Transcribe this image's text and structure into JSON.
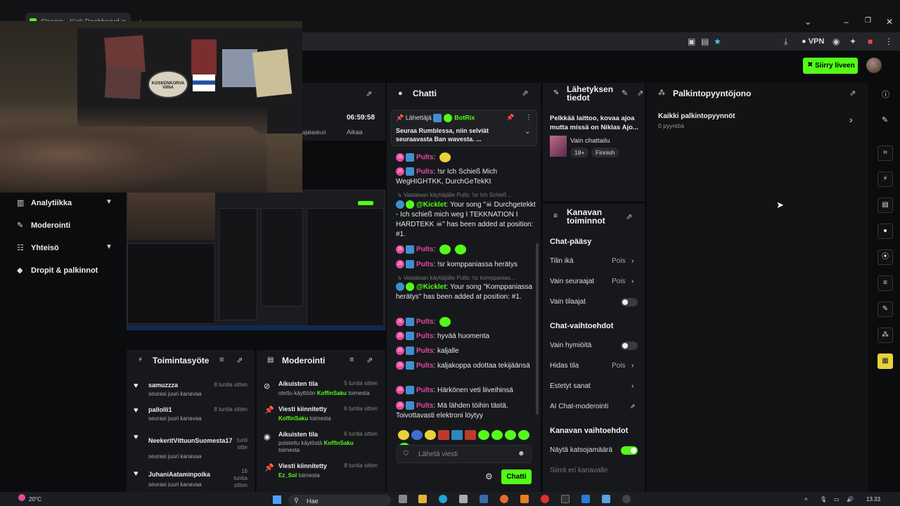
{
  "browser": {
    "tab_title": "Stream - Kick Dashboard",
    "vpn_label": "VPN",
    "win_min": "–",
    "win_max": "❐",
    "win_close": "✕",
    "new_tab": "+"
  },
  "header": {
    "go_live_label": "Siirry liveen"
  },
  "sidebar": {
    "items": [
      {
        "label": "Analytiikka"
      },
      {
        "label": "Moderointi"
      },
      {
        "label": "Yhteisö"
      },
      {
        "label": "Dropit & palkinnot"
      }
    ]
  },
  "webcam": {
    "badge_text": "KOSKENKORVA VIINA"
  },
  "stats": {
    "time_value": "06:59:58",
    "time_label": "Aikaa",
    "counter_label": "ajalaskuri"
  },
  "chat": {
    "title": "Chatti",
    "pinned": {
      "pinned_by_prefix": "Lähettäjä",
      "pinned_by_user": "BotRix",
      "text": "Seuraa Rumblessa, niin selviät seuraavasta Ban wavesta.",
      "ellipsis": "..."
    },
    "messages": [
      {
        "user": "Pults",
        "text": ""
      },
      {
        "user": "Pults",
        "text": "!sr Ich Schieß Mich WegHIGHTKK, DurchGeTekKt"
      },
      {
        "reply": "Vastataan käyttäjälle Pults: !sr Ich Schieß ..."
      },
      {
        "user": "@Kicklet",
        "text": "Your song \"☠ Durchgetekkt - Ich schieß mich weg I TEKKNATION I HARDTEKK ☠\" has been added at position: #1."
      },
      {
        "user": "Pults",
        "text": ""
      },
      {
        "user": "Pults",
        "text": "!sr komppaniassa herätys"
      },
      {
        "reply": "Vastataan käyttäjälle Pults: !sr komppanias..."
      },
      {
        "user": "@Kicklet",
        "text": "Your song \"Komppaniassa herätys\" has been added at position: #1."
      },
      {
        "user": "Pults",
        "text": ""
      },
      {
        "user": "Pults",
        "text": "hyvää huomenta"
      },
      {
        "user": "Pults",
        "text": "kaljalle"
      },
      {
        "user": "Pults",
        "text": "kaljakoppa odottaa tekijäänsä"
      },
      {
        "user": "Pults",
        "text": "Härkönen veti liiveihinsä"
      },
      {
        "user": "Pults",
        "text": "Mä lähden töihin tästä. Toivottavasti elektroni löytyy"
      }
    ],
    "input_placeholder": "Lähetä viesti",
    "send_label": "Chatti"
  },
  "stream_info": {
    "title": "Lähetyksen tiedot",
    "stream_title": "Pelkkää laittoo, kovaa ajoa mutta missä on Niklas Ajo...",
    "category": "Vain chattailu",
    "tags": [
      "18+",
      "Finnish"
    ]
  },
  "channel_actions": {
    "title": "Kanavan toiminnot",
    "sections": [
      {
        "title": "Chat-pääsy"
      },
      {
        "title": "Chat-vaihtoehdot"
      },
      {
        "title": "Kanavan vaihtoehdot"
      }
    ],
    "rows": {
      "account_age": {
        "label": "Tilin ikä",
        "value": "Pois"
      },
      "followers_only": {
        "label": "Vain seuraajat",
        "value": "Pois"
      },
      "subs_only": {
        "label": "Vain tilaajat",
        "on": false
      },
      "emotes_only": {
        "label": "Vain hymiöitä",
        "on": false
      },
      "slow_mode": {
        "label": "Hidas tila",
        "value": "Pois"
      },
      "banned_words": {
        "label": "Estetyt sanat"
      },
      "ai_mod": {
        "label": "AI Chat-moderointi"
      },
      "show_viewers": {
        "label": "Näytä katsojamäärä",
        "on": true
      },
      "host": {
        "label": "Siirrä eri kanavalle"
      }
    }
  },
  "rewards": {
    "title": "Palkintopyyntöjono",
    "all_label": "Kaikki palkintopyynnöt",
    "count_label": "0 pyyntöä"
  },
  "activity": {
    "title": "Toimintasyöte",
    "items": [
      {
        "name": "samuzzza",
        "sub": "seurasi juuri kanavaa",
        "time": "8 tuntia sitten"
      },
      {
        "name": "pallolli1",
        "sub": "seurasi juuri kanavaa",
        "time": "8 tuntia sitten"
      },
      {
        "name": "NeekeritVittuunSuomesta17",
        "sub": "seurasi juuri kanavaa",
        "time": "tunti sitte"
      },
      {
        "name": "JuhaniAataminpoika",
        "sub": "seurasi juuri kanavaa",
        "time": "16 tuntia sitten"
      }
    ]
  },
  "moderation": {
    "title": "Moderointi",
    "items": [
      {
        "name": "Aikuisten tila",
        "pre": "otettu käyttöön",
        "user": "KoffinSaku",
        "post": "toimesta",
        "time": "5 tuntia sitten"
      },
      {
        "name": "Viesti kiinnitetty",
        "pre": "",
        "user": "KoffinSaku",
        "post": "toimesta",
        "time": "6 tuntia sitten"
      },
      {
        "name": "Aikuisten tila",
        "pre": "poistettu käytöstä",
        "user": "KoffinSaku",
        "post": "toimesta",
        "time": "6 tuntia sitten"
      },
      {
        "name": "Viesti kiinnitetty",
        "pre": "",
        "user": "Ez_Sol",
        "post": "toimesta",
        "time": "8 tuntia sitten"
      }
    ]
  },
  "taskbar": {
    "weather": "20°C",
    "search_label": "Hae",
    "clock": "13.33"
  },
  "colors": {
    "accent": "#53fc18",
    "panel": "#17181b",
    "background": "#0b0c0e",
    "pults": "#e14aa0"
  },
  "icons": {
    "pin": "pin-icon",
    "expand": "expand-icon",
    "heart": "heart-icon",
    "settings": "gear-icon"
  }
}
